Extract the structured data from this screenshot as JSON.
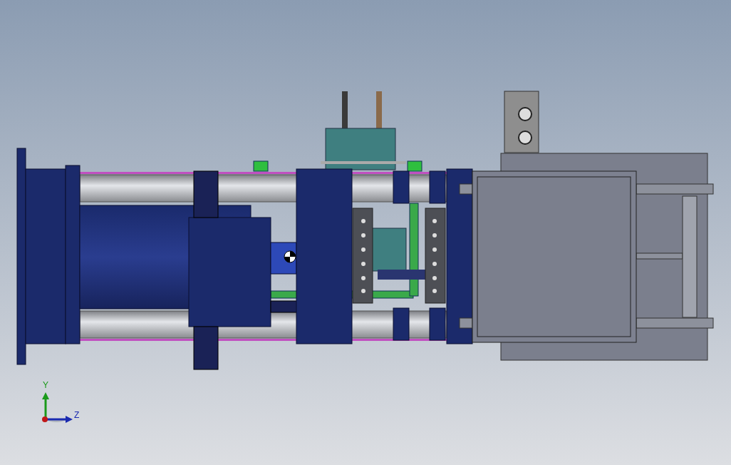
{
  "triad": {
    "axes": [
      {
        "label": "Y",
        "kind": "vertical"
      },
      {
        "label": "Z",
        "kind": "horizontal"
      }
    ]
  }
}
